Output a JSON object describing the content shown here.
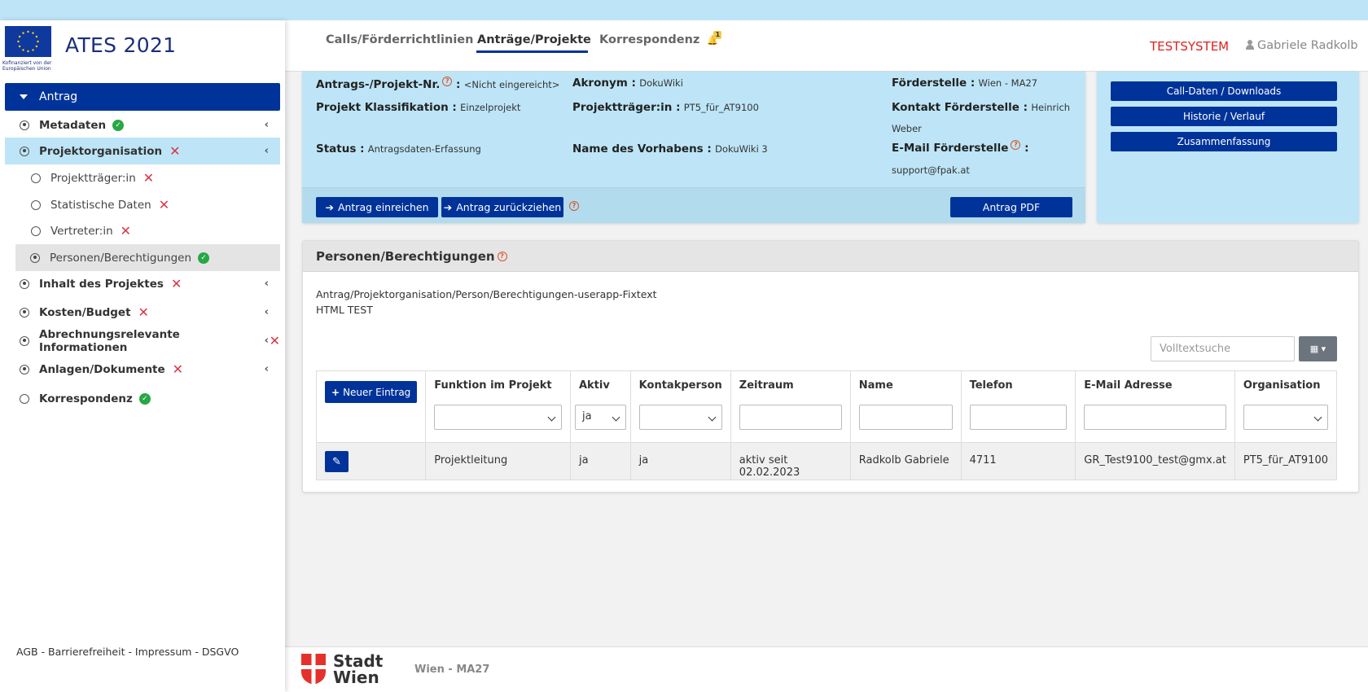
{
  "app": {
    "title": "ATES 2021",
    "eu_caption": "Kofinanziert von der Europäischen Union"
  },
  "topnav": {
    "tabs": [
      {
        "label": "Calls/Förderrichtlinien"
      },
      {
        "label": "Anträge/Projekte"
      },
      {
        "label": "Korrespondenz"
      }
    ],
    "bell_badge": "1",
    "testsystem": "TESTSYSTEM",
    "user": "Gabriele Radkolb"
  },
  "sidebar": {
    "head": "Antrag",
    "items": [
      {
        "label": "Metadaten"
      },
      {
        "label": "Projektorganisation"
      },
      {
        "label": "Projektträger:in"
      },
      {
        "label": "Statistische Daten"
      },
      {
        "label": "Vertreter:in"
      },
      {
        "label": "Personen/Berechtigungen"
      },
      {
        "label": "Inhalt des Projektes"
      },
      {
        "label": "Kosten/Budget"
      },
      {
        "label": "Abrechnungsrelevante Informationen"
      },
      {
        "label": "Anlagen/Dokumente"
      },
      {
        "label": "Korrespondenz"
      }
    ],
    "footer": "AGB - Barrierefreiheit - Impressum - DSGVO"
  },
  "info": {
    "antrag_nr_label": "Antrags-/Projekt-Nr.",
    "antrag_nr_value": "<Nicht eingereicht>",
    "klassifikation_label": "Projekt Klassifikation :",
    "klassifikation_value": "Einzelprojekt",
    "status_label": "Status :",
    "status_value": "Antragsdaten-Erfassung",
    "akronym_label": "Akronym :",
    "akronym_value": "DokuWiki",
    "traeger_label": "Projektträger:in :",
    "traeger_value": "PT5_für_AT9100",
    "vorhaben_label": "Name des Vorhabens :",
    "vorhaben_value": "DokuWiki 3",
    "foerderstelle_label": "Förderstelle :",
    "foerderstelle_value": "Wien - MA27",
    "kontakt_label": "Kontakt Förderstelle :",
    "kontakt_value_1": "Heinrich",
    "kontakt_value_2": "Weber",
    "email_label": "E-Mail Förderstelle",
    "email_value": "support@fpak.at",
    "btn_einreichen": "Antrag einreichen",
    "btn_zurueck": "Antrag zurückziehen",
    "btn_pdf": "Antrag PDF"
  },
  "side": {
    "btn_calldaten": "Call-Daten / Downloads",
    "btn_historie": "Historie / Verlauf",
    "btn_zusammenfassung": "Zusammenfassung"
  },
  "persons": {
    "title": "Personen/Berechtigungen",
    "fixtext_1": "Antrag/Projektorganisation/Person/Berechtigungen-userapp-Fixtext",
    "fixtext_2": "HTML TEST",
    "search_placeholder": "Volltextsuche",
    "new_button": "Neuer Eintrag",
    "columns": [
      "Funktion im Projekt",
      "Aktiv",
      "Kontakperson",
      "Zeitraum",
      "Name",
      "Telefon",
      "E-Mail Adresse",
      "Organisation"
    ],
    "filter_aktiv": "ja",
    "rows": [
      {
        "funktion": "Projektleitung",
        "aktiv": "ja",
        "kontakt": "ja",
        "zeitraum": "aktiv seit 02.02.2023",
        "name": "Radkolb Gabriele",
        "telefon": "4711",
        "email": "GR_Test9100_test@gmx.at",
        "organisation": "PT5_für_AT9100"
      }
    ]
  },
  "footer": {
    "logo_text_1": "Stadt",
    "logo_text_2": "Wien",
    "dept": "Wien - MA27"
  },
  "colors": {
    "primary": "#003399",
    "light_blue": "#bde5f7",
    "success": "#28a745",
    "danger": "#dc3545",
    "testsystem": "#e02020"
  }
}
